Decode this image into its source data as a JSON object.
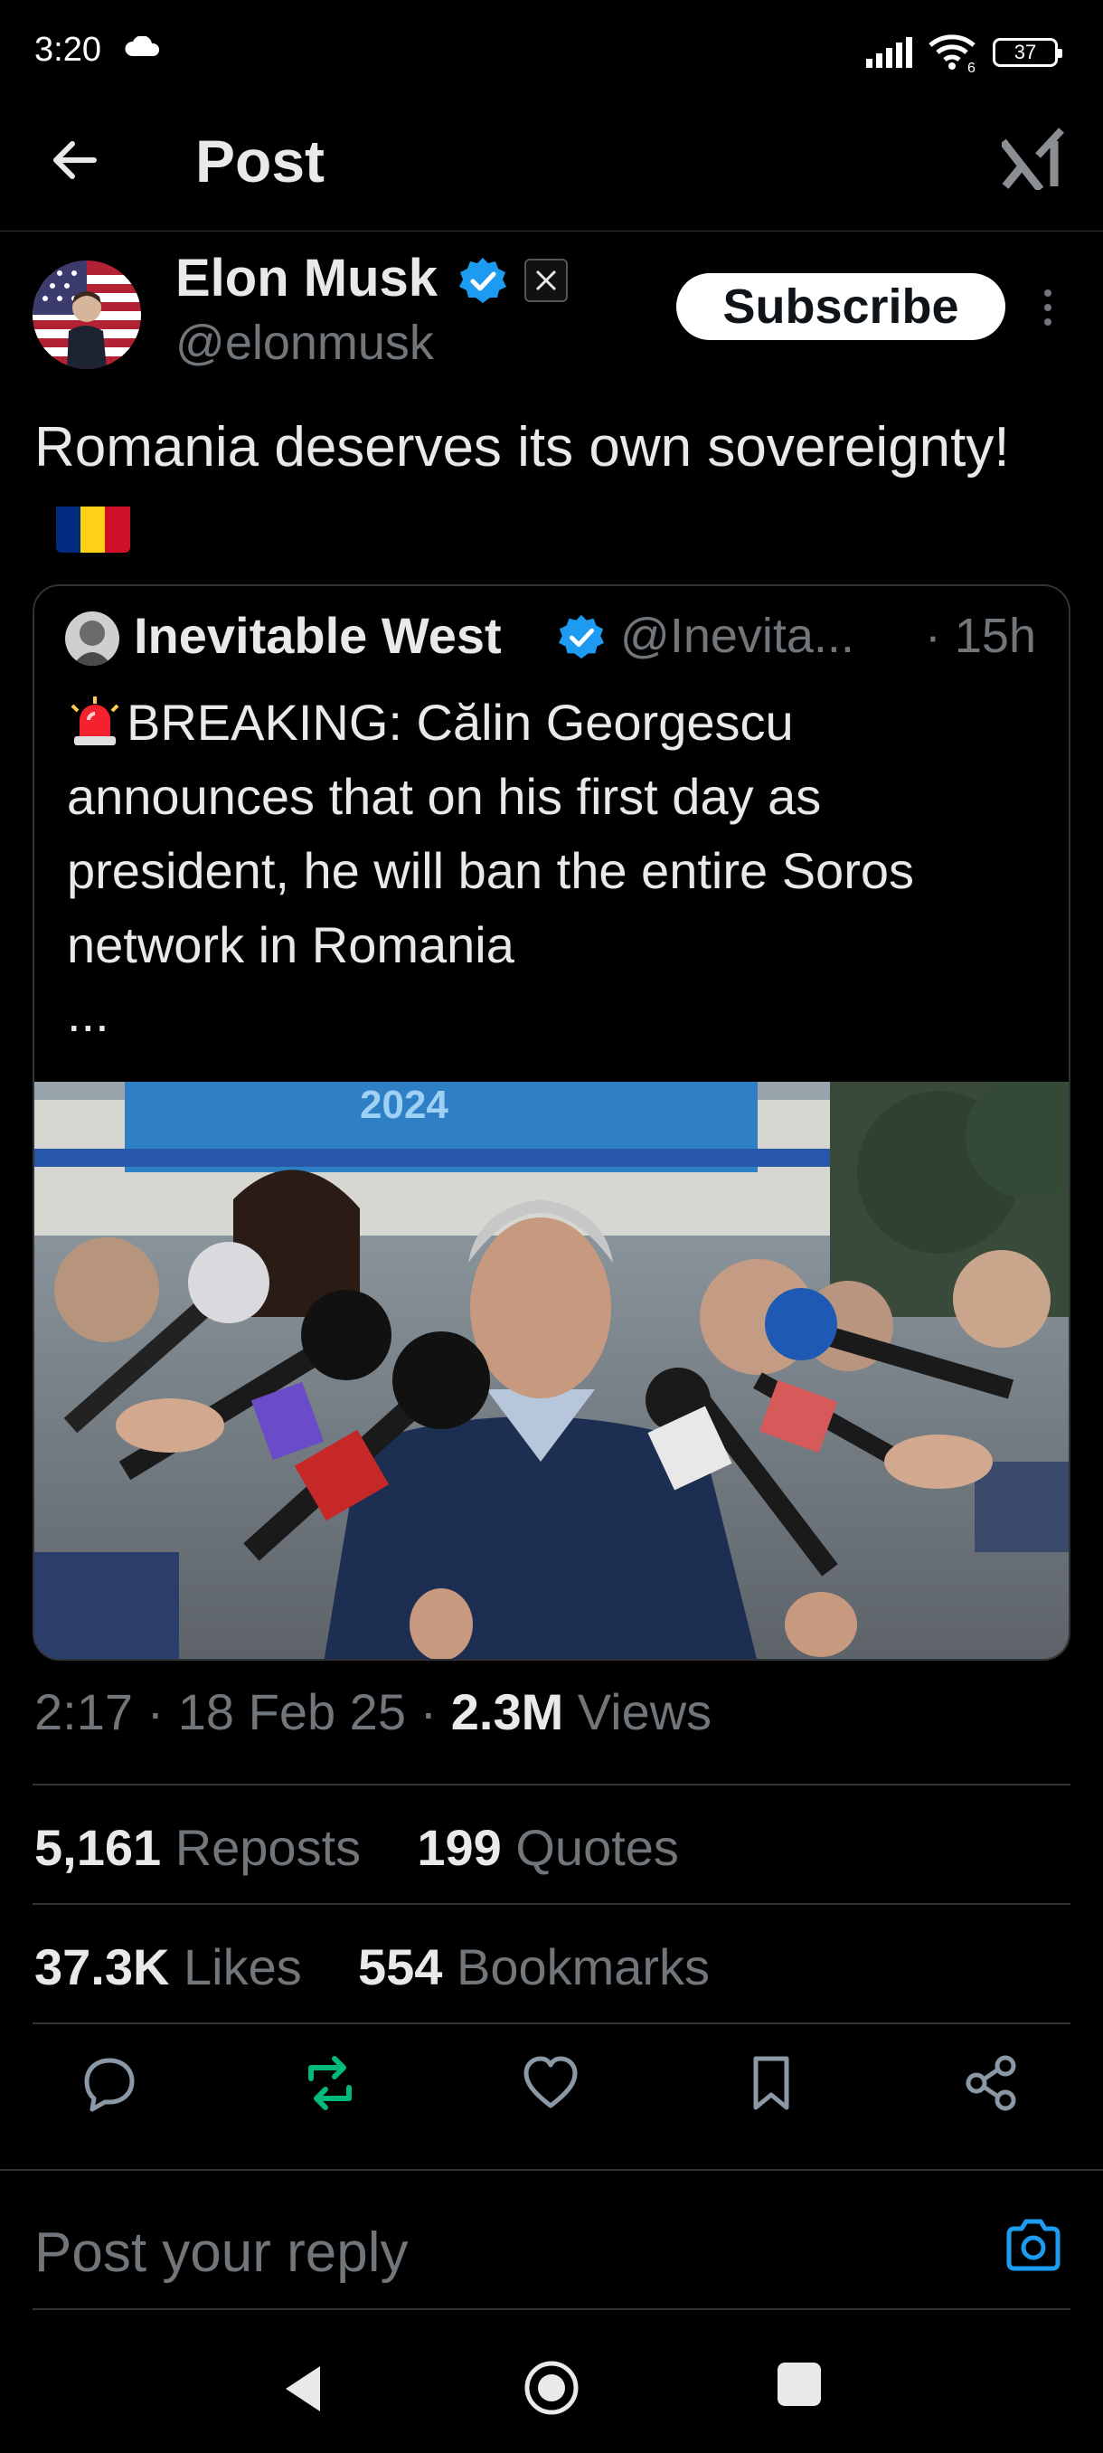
{
  "status_bar": {
    "time": "3:20",
    "battery": "37",
    "wifi_label": "6"
  },
  "header": {
    "title": "Post"
  },
  "author": {
    "name": "Elon Musk",
    "handle": "@elonmusk",
    "subscribe_label": "Subscribe"
  },
  "post": {
    "text": "Romania deserves its own sovereignty!"
  },
  "quote": {
    "name": "Inevitable West",
    "handle": "@Inevita...",
    "time": "· 15h",
    "text": "BREAKING: Călin Georgescu announces that on his first day as president, he will ban the entire Soros network in Romania",
    "ellipsis": "...",
    "image_banner_text": "2024"
  },
  "meta": {
    "time": "2:17",
    "date": "18 Feb 25",
    "views_count": "2.3M",
    "views_label": "Views"
  },
  "stats": {
    "reposts_count": "5,161",
    "reposts_label": "Reposts",
    "quotes_count": "199",
    "quotes_label": "Quotes",
    "likes_count": "37.3K",
    "likes_label": "Likes",
    "bookmarks_count": "554",
    "bookmarks_label": "Bookmarks"
  },
  "reply": {
    "placeholder": "Post your reply"
  },
  "colors": {
    "verified": "#1d9bf0",
    "repost_active": "#00ba7c",
    "camera": "#1d9bf0",
    "background": "#000000"
  }
}
